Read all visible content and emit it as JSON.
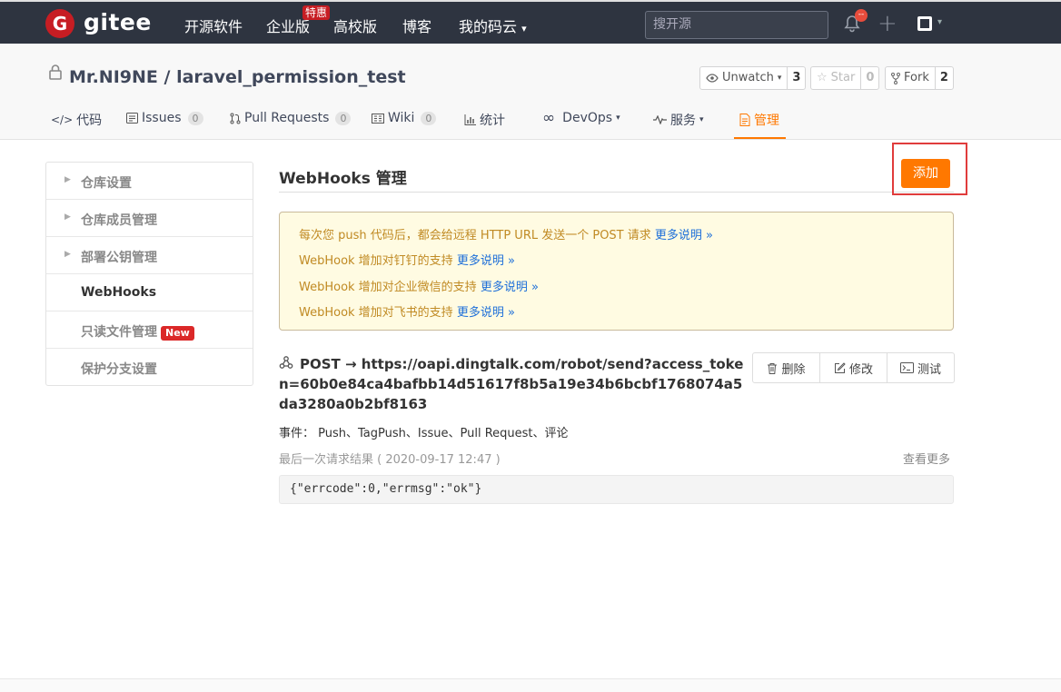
{
  "nav": {
    "logo_letter": "G",
    "brand": "gitee",
    "links": [
      "开源软件",
      "企业版",
      "高校版",
      "博客",
      "我的码云"
    ],
    "special_badge": "特惠",
    "search_placeholder": "搜开源",
    "notif_count": "--",
    "dropdown_caret": "▾"
  },
  "repo": {
    "owner": "Mr.NI9NE",
    "separator": "/",
    "name": "laravel_permission_test",
    "watch": {
      "label": "Unwatch",
      "count": "3"
    },
    "star": {
      "label": "Star",
      "count": "0"
    },
    "fork": {
      "label": "Fork",
      "count": "2"
    }
  },
  "tabs": [
    {
      "label": "代码",
      "icon": "code-icon"
    },
    {
      "label": "Issues",
      "count": "0",
      "icon": "issues-icon"
    },
    {
      "label": "Pull Requests",
      "count": "0",
      "icon": "pr-icon"
    },
    {
      "label": "Wiki",
      "count": "0",
      "icon": "wiki-icon"
    },
    {
      "label": "统计",
      "icon": "chart-icon"
    },
    {
      "label": "DevOps",
      "icon": "infinity-icon"
    },
    {
      "label": "服务",
      "icon": "pulse-icon"
    },
    {
      "label": "管理",
      "icon": "manage-icon",
      "active": true
    }
  ],
  "sidebar": {
    "items": [
      {
        "label": "仓库设置"
      },
      {
        "label": "仓库成员管理"
      },
      {
        "label": "部署公钥管理"
      },
      {
        "label": "WebHooks"
      },
      {
        "label": "只读文件管理",
        "badge": "New"
      },
      {
        "label": "保护分支设置"
      }
    ]
  },
  "main": {
    "title": "WebHooks 管理",
    "add_label": "添加",
    "notice": {
      "line1": "每次您 push 代码后，都会给远程 HTTP URL 发送一个 POST 请求",
      "line2": "WebHook 增加对钉钉的支持",
      "line3": "WebHook 增加对企业微信的支持",
      "line4": "WebHook 增加对飞书的支持",
      "more": "更多说明 »"
    },
    "hook": {
      "url": "POST → https://oapi.dingtalk.com/robot/send?access_token=60b0e84ca4bafbb14d51617f8b5a19e34b6bcbf1768074a5da3280a0b2bf8163",
      "actions": {
        "delete": "删除",
        "edit": "修改",
        "test": "测试"
      },
      "events": "事件：  Push、TagPush、Issue、Pull Request、评论",
      "last_request": "最后一次请求结果 ( 2020-09-17 12:47 )",
      "see_more": "查看更多",
      "response": "{\"errcode\":0,\"errmsg\":\"ok\"}"
    }
  },
  "colors": {
    "accent": "#ff7800",
    "nav_bg": "#2e3440",
    "brand_red": "#c71d23",
    "highlight_box": "#e03c3c"
  }
}
